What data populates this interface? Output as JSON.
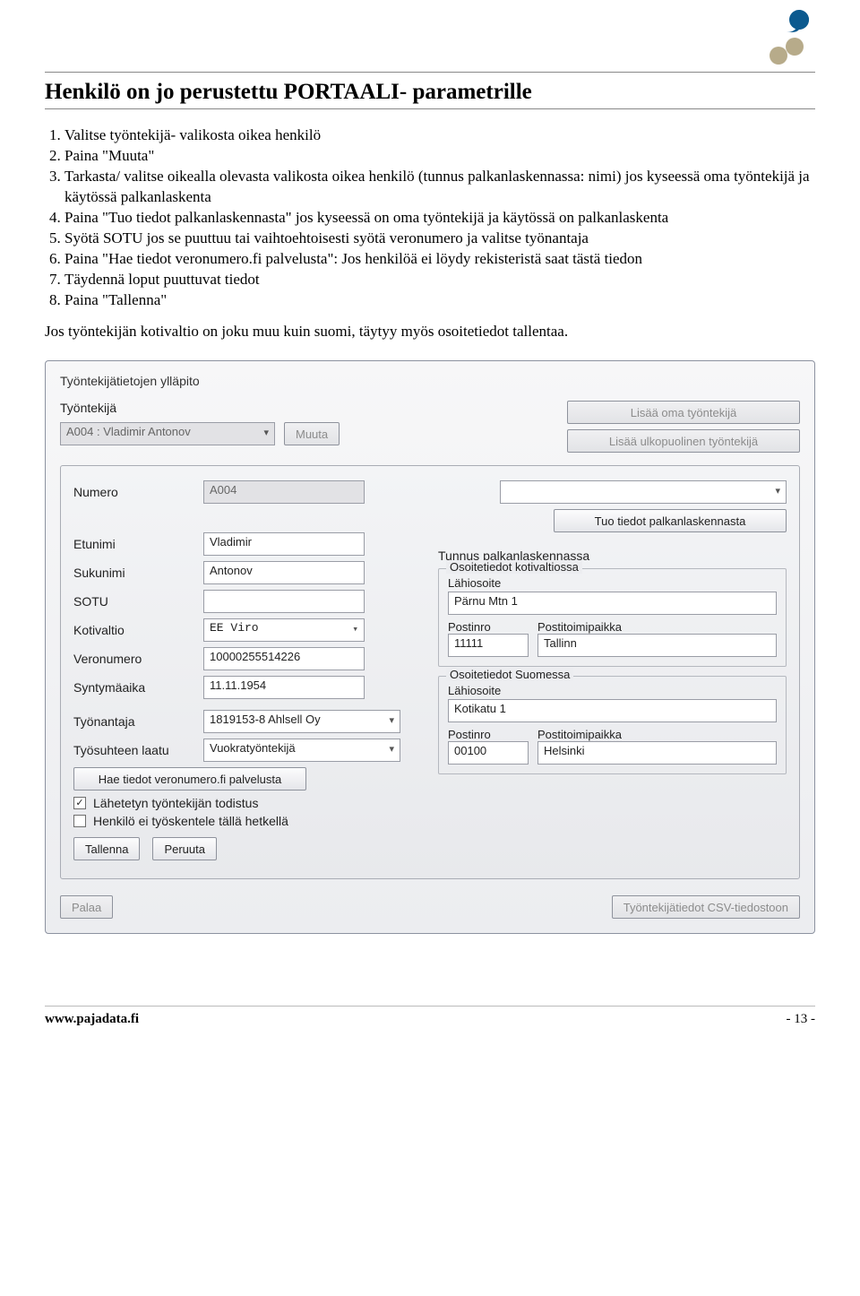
{
  "heading": "Henkilö on jo perustettu PORTAALI- parametrille",
  "steps": [
    "Valitse työntekijä- valikosta oikea henkilö",
    "Paina \"Muuta\"",
    "Tarkasta/ valitse oikealla olevasta valikosta oikea henkilö (tunnus palkanlaskennassa: nimi) jos kyseessä oma työntekijä ja käytössä palkanlaskenta",
    "Paina \"Tuo tiedot palkanlaskennasta\" jos kyseessä on oma työntekijä ja käytössä on palkanlaskenta",
    "Syötä SOTU jos se puuttuu tai vaihtoehtoisesti syötä veronumero ja valitse työnantaja",
    "Paina \"Hae tiedot veronumero.fi palvelusta\": Jos henkilöä ei löydy rekisteristä saat tästä tiedon",
    "Täydennä loput puuttuvat tiedot",
    "Paina \"Tallenna\""
  ],
  "note": "Jos työntekijän kotivaltio on joku muu kuin suomi, täytyy myös osoitetiedot tallentaa.",
  "app": {
    "title": "Työntekijätietojen ylläpito",
    "labels": {
      "tyontekija": "Työntekijä",
      "numero": "Numero",
      "etunimi": "Etunimi",
      "sukunimi": "Sukunimi",
      "sotu": "SOTU",
      "kotivaltio": "Kotivaltio",
      "veronumero": "Veronumero",
      "syntymaaika": "Syntymäaika",
      "tyonantaja": "Työnantaja",
      "tyosuhteen_laatu": "Työsuhteen laatu",
      "tunnus_palkanlask": "Tunnus palkanlaskennassa",
      "osoite_koti_title": "Osoitetiedot kotivaltiossa",
      "osoite_suomi_title": "Osoitetiedot Suomessa",
      "lahiosoite": "Lähiosoite",
      "postinro": "Postinro",
      "postitoimipaikka": "Postitoimipaikka"
    },
    "buttons": {
      "muuta": "Muuta",
      "lisaa_oma": "Lisää oma työntekijä",
      "lisaa_ulko": "Lisää ulkopuolinen työntekijä",
      "tuo_palkanlask": "Tuo tiedot palkanlaskennasta",
      "hae_verofi": "Hae tiedot veronumero.fi palvelusta",
      "tallenna": "Tallenna",
      "peruuta": "Peruuta",
      "palaa": "Palaa",
      "csv": "Työntekijätiedot CSV-tiedostoon"
    },
    "values": {
      "tyontekija_sel": "A004 : Vladimir Antonov",
      "numero": "A004",
      "etunimi": "Vladimir",
      "sukunimi": "Antonov",
      "sotu": "",
      "kotivaltio": "EE Viro",
      "veronumero": "10000255514226",
      "syntymaaika": "11.11.1954",
      "tyonantaja": "1819153-8 Ahlsell Oy",
      "tyosuhteen_laatu": "Vuokratyöntekijä",
      "koti_lahiosoite": "Pärnu Mtn 1",
      "koti_postinro": "11111",
      "koti_postitmp": "Tallinn",
      "suomi_lahiosoite": "Kotikatu 1",
      "suomi_postinro": "00100",
      "suomi_postitmp": "Helsinki"
    },
    "checks": {
      "lahetetyn_todistus": "Lähetetyn työntekijän todistus",
      "ei_tyoskentele": "Henkilö ei työskentele tällä hetkellä"
    }
  },
  "footer": {
    "url": "www.pajadata.fi",
    "pagenum": "- 13 -"
  }
}
